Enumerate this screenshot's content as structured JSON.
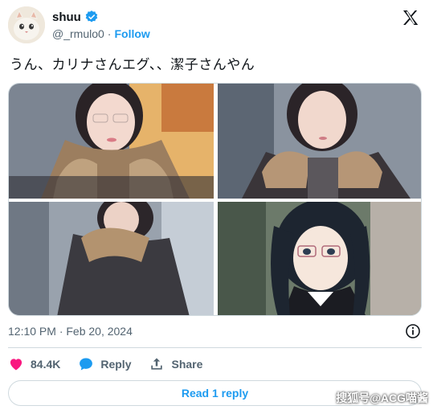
{
  "author": {
    "display_name": "shuu",
    "handle": "@_rmulo0",
    "separator": "·",
    "follow_label": "Follow"
  },
  "tweet": {
    "text": "うん、カリナさんエグ、、潔子さんやん"
  },
  "meta": {
    "timestamp": "12:10 PM · Feb 20, 2024"
  },
  "actions": {
    "likes": "84.4K",
    "reply_label": "Reply",
    "share_label": "Share"
  },
  "read_replies_label": "Read 1 reply",
  "watermark": "搜狐号@ACG喵酱",
  "colors": {
    "accent": "#1d9bf0",
    "like": "#f91880",
    "muted": "#536471",
    "border": "#cfd9de"
  },
  "icons": [
    "verified-icon",
    "x-logo-icon",
    "info-icon",
    "heart-icon",
    "reply-bubble-icon",
    "share-icon"
  ]
}
